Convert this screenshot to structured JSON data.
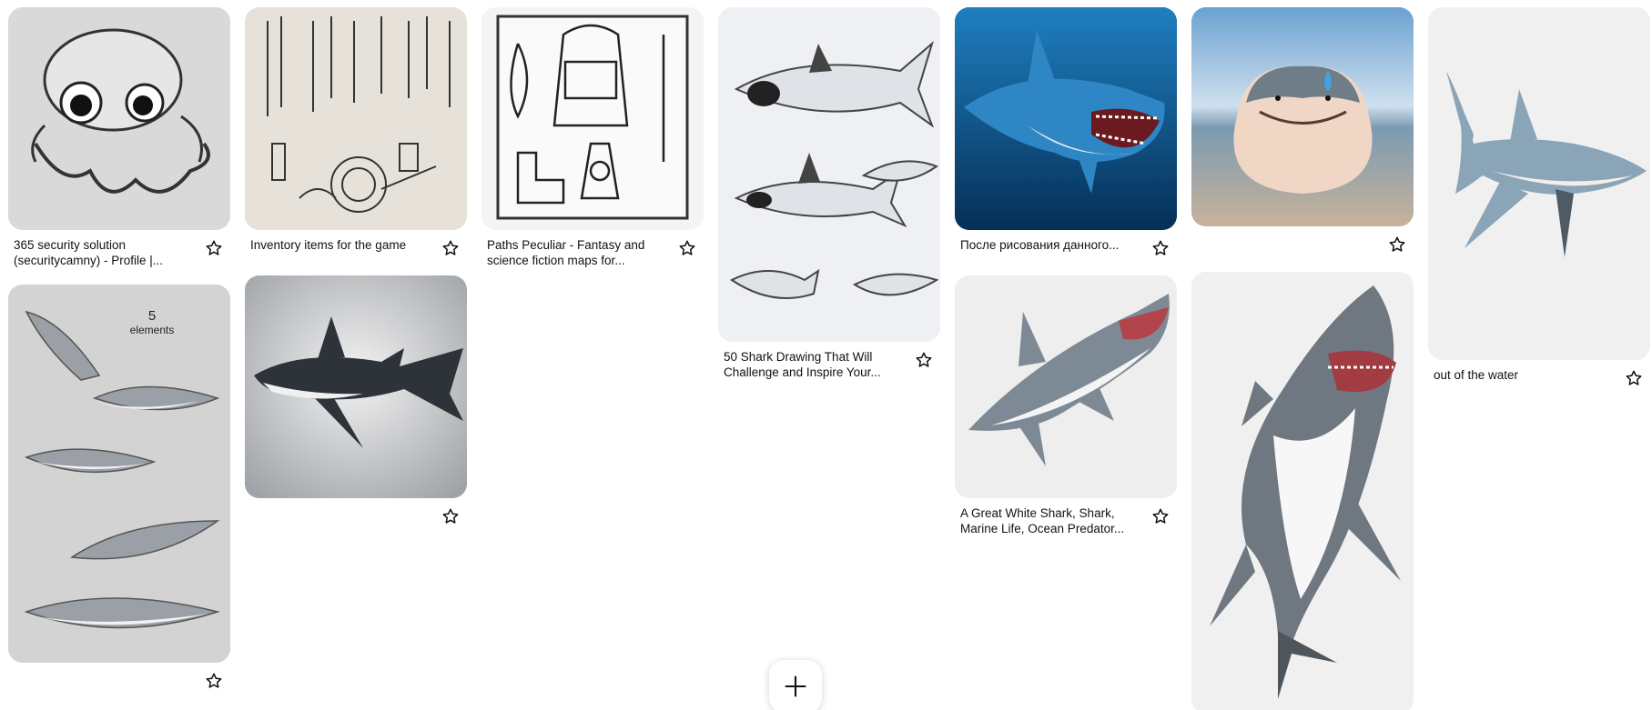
{
  "columns": [
    {
      "pins": [
        {
          "title": "365 security solution (securitycamny) - Profile |...",
          "art": "octopus-sketch"
        },
        {
          "title": "",
          "art": "shark-collage",
          "counter": {
            "number": "5",
            "label": "elements"
          }
        }
      ]
    },
    {
      "pins": [
        {
          "title": "Inventory items for the game",
          "art": "weapons-sketch"
        },
        {
          "title": "",
          "art": "dark-shark"
        }
      ]
    },
    {
      "pins": [
        {
          "title": "Paths Peculiar - Fantasy and science fiction maps for...",
          "art": "backpack-sketch"
        }
      ]
    },
    {
      "pins": [
        {
          "title": "50 Shark Drawing That Will Challenge and Inspire Your...",
          "art": "shark-sketches"
        }
      ]
    },
    {
      "pins": [
        {
          "title": "После рисования данного...",
          "art": "blue-shark"
        },
        {
          "title": "A Great White Shark, Shark, Marine Life, Ocean Predator...",
          "art": "white-shark"
        }
      ]
    },
    {
      "pins": [
        {
          "title": "",
          "art": "chubby-shark"
        },
        {
          "title": "",
          "art": "tall-shark"
        }
      ]
    },
    {
      "pins": [
        {
          "title": "out of the water",
          "art": "blue-grey-shark"
        }
      ]
    }
  ],
  "icons": {
    "save": "star-outline-icon",
    "add": "plus-icon"
  },
  "colors": {
    "text": "#111111",
    "card_bg": "#eeeeee",
    "shark_grey": "#7a8590",
    "sea_blue": "#0b4f86"
  }
}
